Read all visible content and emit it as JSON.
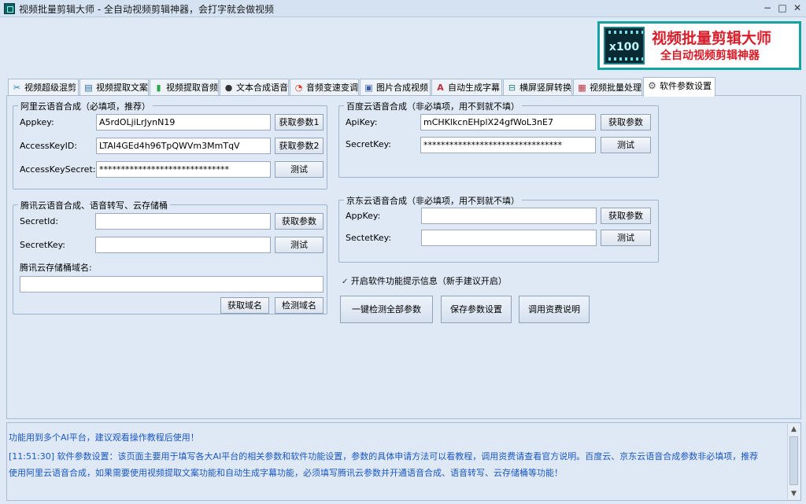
{
  "window": {
    "title": "视频批量剪辑大师 - 全自动视频剪辑神器，会打字就会做视频",
    "minimize": "−",
    "maximize": "□",
    "close": "✕"
  },
  "banner": {
    "logo_text": "x100",
    "title": "视频批量剪辑大师",
    "subtitle": "全自动视频剪辑神器"
  },
  "tabs": [
    {
      "label": "视频超级混剪",
      "icon": "scissors-icon",
      "glyph": "✂"
    },
    {
      "label": "视频提取文案",
      "icon": "document-icon",
      "glyph": "▤"
    },
    {
      "label": "视频提取音频",
      "icon": "audio-wave-icon",
      "glyph": "▮"
    },
    {
      "label": "文本合成语音",
      "icon": "microphone-icon",
      "glyph": "●"
    },
    {
      "label": "音频变速变调",
      "icon": "gauge-icon",
      "glyph": "◔"
    },
    {
      "label": "图片合成视频",
      "icon": "image-icon",
      "glyph": "▣"
    },
    {
      "label": "自动生成字幕",
      "icon": "subtitle-icon",
      "glyph": "A"
    },
    {
      "label": "横屏竖屏转换",
      "icon": "rotate-screen-icon",
      "glyph": "⊟"
    },
    {
      "label": "视频批量处理",
      "icon": "film-icon",
      "glyph": "▦"
    },
    {
      "label": "软件参数设置",
      "icon": "gear-icon",
      "glyph": "⚙"
    }
  ],
  "aliyun": {
    "legend": "阿里云语音合成（必填项，推荐）",
    "appkey_label": "Appkey:",
    "appkey_value": "A5rdOLjiLrJynN19",
    "get_param1": "获取参数1",
    "accesskeyid_label": "AccessKeyID:",
    "accesskeyid_value": "LTAI4GEd4h96TpQWVm3MmTqV",
    "get_param2": "获取参数2",
    "secret_label": "AccessKeySecret:",
    "secret_value": "******************************",
    "test": "测试"
  },
  "tencent": {
    "legend": "腾讯云语音合成、语音转写、云存储桶",
    "secretid_label": "SecretId:",
    "secretid_value": "",
    "get_param": "获取参数",
    "secretkey_label": "SecretKey:",
    "secretkey_value": "",
    "test": "测试",
    "bucket_label": "腾讯云存储桶域名:",
    "bucket_value": "",
    "get_domain": "获取域名",
    "check_domain": "检测域名"
  },
  "baidu": {
    "legend": "百度云语音合成（非必填项，用不到就不填）",
    "apikey_label": "ApiKey:",
    "apikey_value": "mCHKlkcnEHplX24gfWoL3nE7",
    "get_param": "获取参数",
    "secretkey_label": "SecretKey:",
    "secretkey_value": "********************************",
    "test": "测试"
  },
  "jd": {
    "legend": "京东云语音合成（非必填项，用不到就不填）",
    "appkey_label": "AppKey:",
    "appkey_value": "",
    "get_param": "获取参数",
    "sectetkey_label": "SectetKey:",
    "sectetkey_value": "",
    "test": "测试"
  },
  "options": {
    "tips_checkbox": "开启软件功能提示信息（新手建议开启）",
    "tips_checked": true
  },
  "actions": {
    "check_all": "一键检测全部参数",
    "save": "保存参数设置",
    "fee_info": "调用资费说明"
  },
  "log": {
    "line1": "功能用到多个AI平台，建议观看操作教程后使用！",
    "line2": "[11:51:30] 软件参数设置：该页面主要用于填写各大AI平台的相关参数和软件功能设置，参数的具体申请方法可以看教程，调用资费请查看官方说明。百度云、京东云语音合成参数非必填项，推荐",
    "line3": "使用阿里云语音合成，如果需要使用视频提取文案功能和自动生成字幕功能，必须填写腾讯云参数并开通语音合成、语音转写、云存储桶等功能！"
  },
  "colors": {
    "accent": "#16a2a2",
    "brand_red": "#d81e2a",
    "log_text": "#1a56c4"
  }
}
